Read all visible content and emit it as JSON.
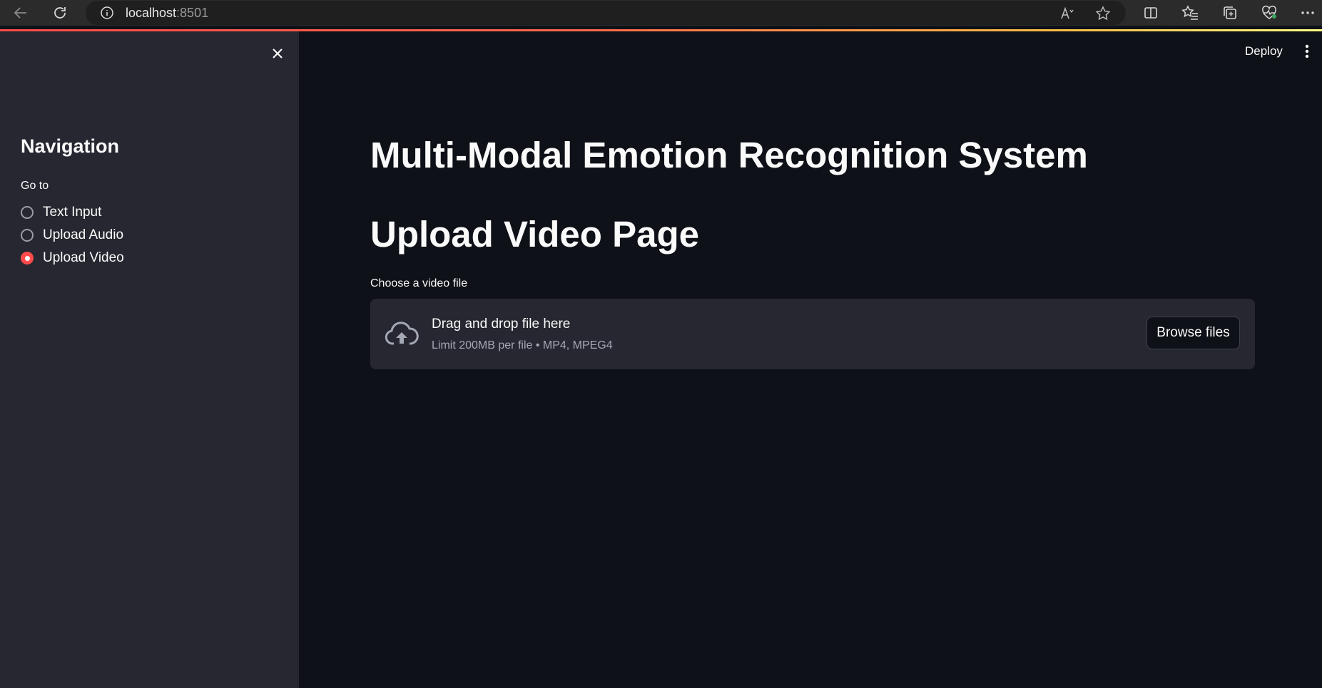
{
  "browser": {
    "url_host": "localhost",
    "url_port": ":8501"
  },
  "sidebar": {
    "title": "Navigation",
    "radio_label": "Go to",
    "options": [
      {
        "label": "Text Input",
        "checked": false
      },
      {
        "label": "Upload Audio",
        "checked": false
      },
      {
        "label": "Upload Video",
        "checked": true
      }
    ]
  },
  "header": {
    "deploy_label": "Deploy"
  },
  "main": {
    "title": "Multi-Modal Emotion Recognition System",
    "subtitle": "Upload Video Page",
    "uploader": {
      "label": "Choose a video file",
      "drag_text": "Drag and drop file here",
      "limit_text": "Limit 200MB per file • MP4, MPEG4",
      "browse_label": "Browse files"
    }
  },
  "colors": {
    "primary": "#ff4b4b",
    "background": "#0e1117",
    "sidebar_bg": "#262730"
  },
  "icons": [
    "back-arrow-icon",
    "refresh-icon",
    "info-icon",
    "read-aloud-icon",
    "favorite-star-icon",
    "split-screen-icon",
    "favorites-icon",
    "collections-icon",
    "browser-essentials-icon",
    "more-icon",
    "close-icon",
    "kebab-menu-icon",
    "cloud-upload-icon"
  ]
}
